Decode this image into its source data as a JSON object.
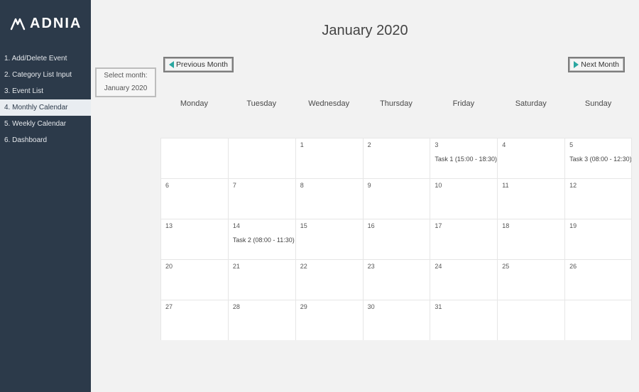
{
  "logo_text": "ADNIA",
  "sidebar": {
    "items": [
      {
        "label": "1. Add/Delete Event",
        "key": "add-delete-event"
      },
      {
        "label": "2. Category List Input",
        "key": "category-list-input"
      },
      {
        "label": "3. Event List",
        "key": "event-list"
      },
      {
        "label": "4. Monthly Calendar",
        "key": "monthly-calendar"
      },
      {
        "label": "5. Weekly Calendar",
        "key": "weekly-calendar"
      },
      {
        "label": "6. Dashboard",
        "key": "dashboard"
      }
    ],
    "active_index": 3
  },
  "header": {
    "title": "January 2020"
  },
  "select_month": {
    "label": "Select month:",
    "value": "January 2020"
  },
  "nav_buttons": {
    "prev": "Previous Month",
    "next": "Next Month"
  },
  "days": [
    "Monday",
    "Tuesday",
    "Wednesday",
    "Thursday",
    "Friday",
    "Saturday",
    "Sunday"
  ],
  "calendar": {
    "rows": [
      [
        {
          "num": "",
          "event": ""
        },
        {
          "num": "",
          "event": ""
        },
        {
          "num": "1",
          "event": ""
        },
        {
          "num": "2",
          "event": ""
        },
        {
          "num": "3",
          "event": "Task 1 (15:00 - 18:30)"
        },
        {
          "num": "4",
          "event": ""
        },
        {
          "num": "5",
          "event": "Task 3 (08:00 - 12:30)"
        }
      ],
      [
        {
          "num": "6",
          "event": ""
        },
        {
          "num": "7",
          "event": ""
        },
        {
          "num": "8",
          "event": ""
        },
        {
          "num": "9",
          "event": ""
        },
        {
          "num": "10",
          "event": ""
        },
        {
          "num": "11",
          "event": ""
        },
        {
          "num": "12",
          "event": ""
        }
      ],
      [
        {
          "num": "13",
          "event": ""
        },
        {
          "num": "14",
          "event": "Task 2 (08:00 - 11:30)"
        },
        {
          "num": "15",
          "event": ""
        },
        {
          "num": "16",
          "event": ""
        },
        {
          "num": "17",
          "event": ""
        },
        {
          "num": "18",
          "event": ""
        },
        {
          "num": "19",
          "event": ""
        }
      ],
      [
        {
          "num": "20",
          "event": ""
        },
        {
          "num": "21",
          "event": ""
        },
        {
          "num": "22",
          "event": ""
        },
        {
          "num": "23",
          "event": ""
        },
        {
          "num": "24",
          "event": ""
        },
        {
          "num": "25",
          "event": ""
        },
        {
          "num": "26",
          "event": ""
        }
      ],
      [
        {
          "num": "27",
          "event": ""
        },
        {
          "num": "28",
          "event": ""
        },
        {
          "num": "29",
          "event": ""
        },
        {
          "num": "30",
          "event": ""
        },
        {
          "num": "31",
          "event": ""
        },
        {
          "num": "",
          "event": ""
        },
        {
          "num": "",
          "event": ""
        }
      ]
    ]
  }
}
